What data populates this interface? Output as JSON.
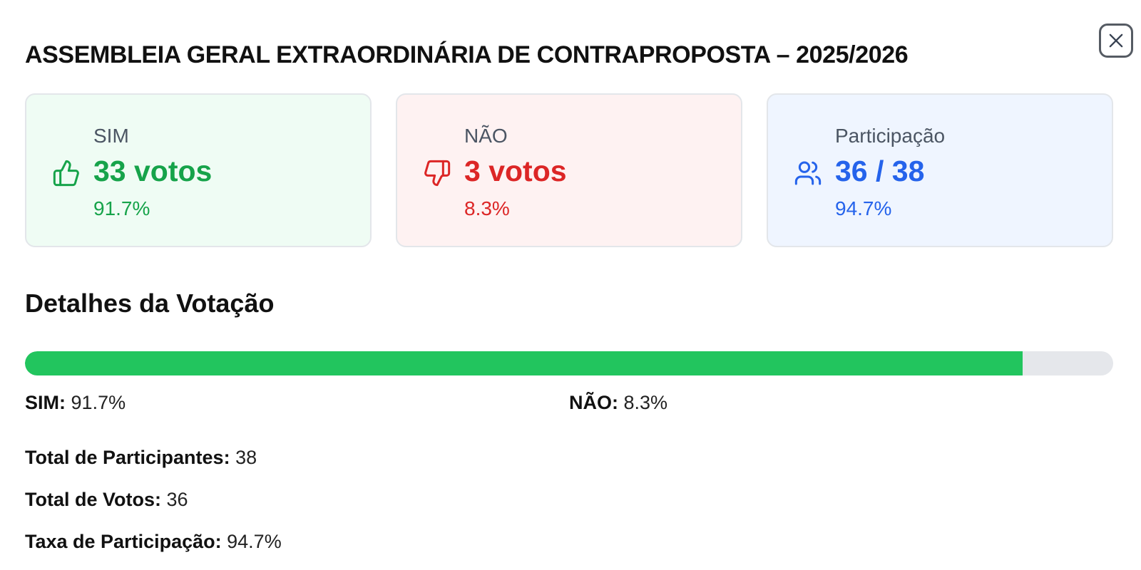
{
  "modal": {
    "title": "ASSEMBLEIA GERAL EXTRAORDINÁRIA DE CONTRAPROPOSTA – 2025/2026",
    "close_icon": "close-icon"
  },
  "cards": {
    "sim": {
      "label": "SIM",
      "value": "33 votos",
      "percent": "91.7%",
      "icon": "thumbs-up-icon",
      "color": "#16a34a",
      "background": "#effcf4"
    },
    "nao": {
      "label": "NÃO",
      "value": "3 votos",
      "percent": "8.3%",
      "icon": "thumbs-down-icon",
      "color": "#dc2626",
      "background": "#fef2f2"
    },
    "participacao": {
      "label": "Participação",
      "value": "36 / 38",
      "percent": "94.7%",
      "icon": "users-icon",
      "color": "#2563eb",
      "background": "#eff5ff"
    }
  },
  "details": {
    "title": "Detalhes da Votação",
    "progress": {
      "sim_fraction": 0.917,
      "fill_color": "#22c55e",
      "track_color": "#e5e7eb"
    },
    "sim_label": "SIM",
    "sim_value": "91.7%",
    "nao_label": "NÃO",
    "nao_value": "8.3%",
    "total_participantes_label": "Total de Participantes",
    "total_participantes_value": "38",
    "total_votos_label": "Total de Votos",
    "total_votos_value": "36",
    "taxa_participacao_label": "Taxa de Participação",
    "taxa_participacao_value": "94.7%"
  }
}
